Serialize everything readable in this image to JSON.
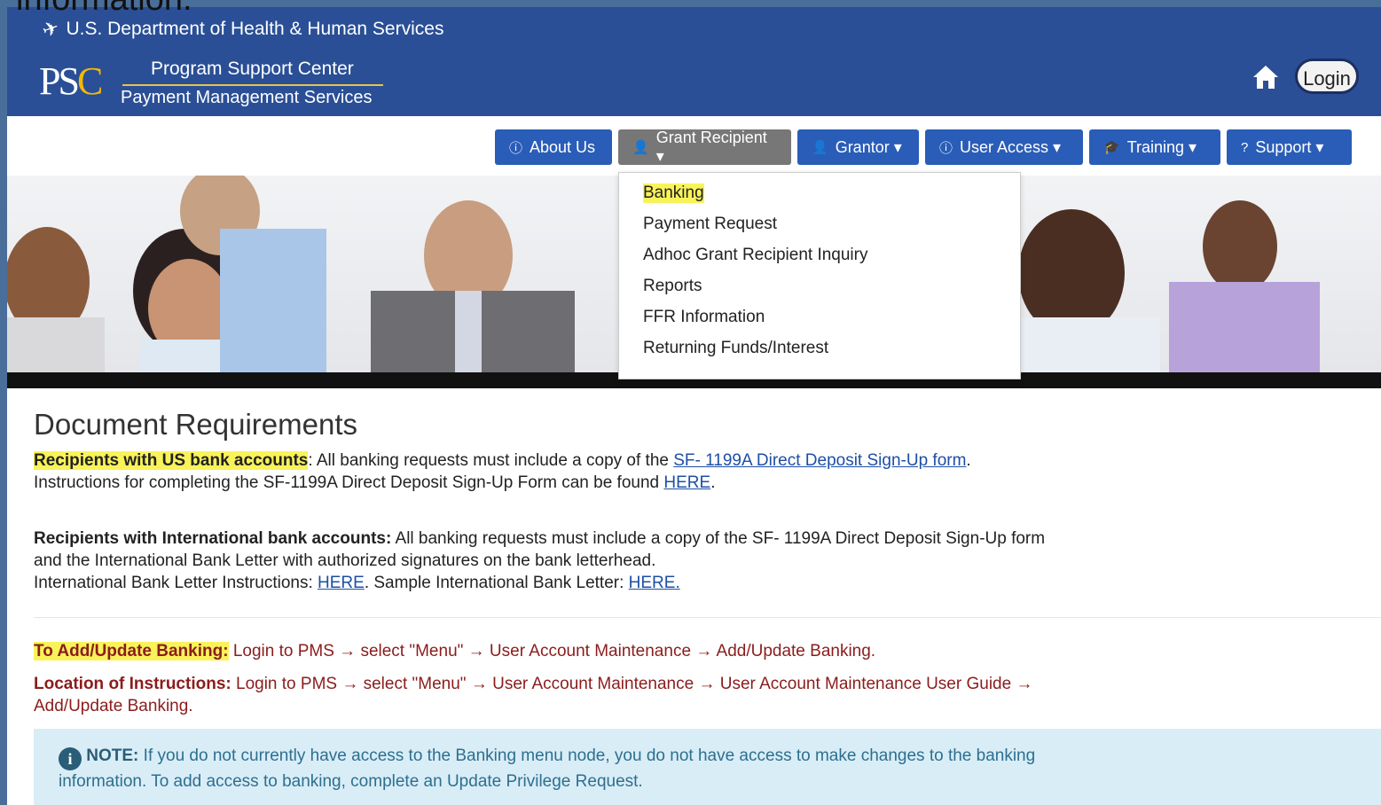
{
  "caption": "information.",
  "header": {
    "agency": "U.S. Department of Health & Human Services",
    "logo_text": "PSC",
    "brand_line1": "Program Support Center",
    "brand_line2": "Payment Management Services",
    "login_label": "Login"
  },
  "nav": {
    "about": "About Us",
    "grant_recipient": "Grant Recipient ▾",
    "grantor": "Grantor ▾",
    "user_access": "User Access ▾",
    "training": "Training ▾",
    "support": "Support ▾"
  },
  "dropdown": {
    "items": [
      "Banking",
      "Payment Request",
      "Adhoc Grant Recipient Inquiry",
      "Reports",
      "FFR Information",
      "Returning Funds/Interest"
    ]
  },
  "doc": {
    "title": "Document Requirements",
    "us_label": "Recipients with US bank accounts",
    "us_text": ": All banking requests must include a copy of the ",
    "us_link": "SF- 1199A Direct Deposit Sign-Up form",
    "us_line2": "Instructions for completing the SF-1199A Direct Deposit Sign-Up Form can be found ",
    "here": "HERE",
    "intl_label": "Recipients with International bank accounts:",
    "intl_text": " All banking requests must include a copy of the SF- 1199A Direct Deposit Sign-Up form",
    "intl_line2": "and the International Bank Letter with authorized signatures on the bank letterhead.",
    "intl_line3": "International Bank Letter Instructions: ",
    "intl_sample": ". Sample International Bank Letter: ",
    "here_dot": "HERE.",
    "add_label": "To Add/Update Banking:",
    "add_text": " Login to PMS → select \"Menu\" → User Account Maintenance → Add/Update Banking.",
    "loc_label": "Location of Instructions:",
    "loc_text": " Login to PMS → select \"Menu\" → User Account Maintenance → User Account Maintenance User Guide →",
    "loc_line2": "Add/Update Banking.",
    "note_label": "NOTE:",
    "note_text": " If you do not currently have access to the Banking menu node, you do not have access to make changes to the banking",
    "note_line2": "information. To add access to banking, complete an Update Privilege Request."
  },
  "colors": {
    "header_blue": "#2a4f96",
    "nav_blue": "#2a5db8",
    "highlight": "#f9f35a",
    "note_bg": "#d9edf7"
  }
}
